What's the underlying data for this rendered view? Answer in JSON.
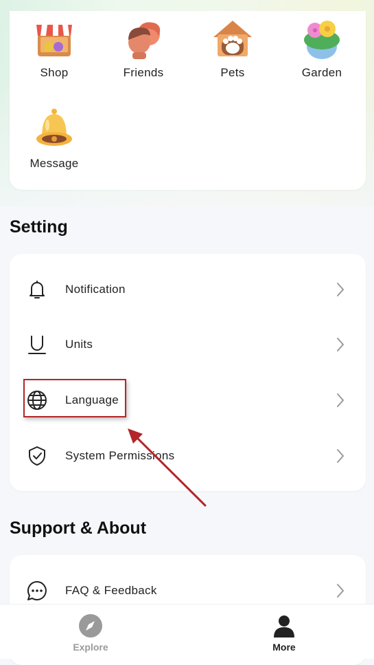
{
  "features": [
    {
      "label": "Shop",
      "icon": "shop-icon"
    },
    {
      "label": "Friends",
      "icon": "friends-icon"
    },
    {
      "label": "Pets",
      "icon": "pets-icon"
    },
    {
      "label": "Garden",
      "icon": "garden-icon"
    },
    {
      "label": "Message",
      "icon": "message-bell-icon"
    }
  ],
  "setting": {
    "title": "Setting",
    "items": [
      {
        "label": "Notification",
        "icon": "bell-outline-icon"
      },
      {
        "label": "Units",
        "icon": "units-icon"
      },
      {
        "label": "Language",
        "icon": "globe-icon"
      },
      {
        "label": "System Permissions",
        "icon": "shield-check-icon"
      }
    ]
  },
  "support": {
    "title": "Support & About",
    "items": [
      {
        "label": "FAQ & Feedback",
        "icon": "chat-bubble-icon"
      }
    ]
  },
  "bottom_nav": [
    {
      "label": "Explore",
      "icon": "compass-icon",
      "active": false
    },
    {
      "label": "More",
      "icon": "person-icon",
      "active": true
    }
  ],
  "colors": {
    "annotation": "#b5242a",
    "nav_active": "#222222",
    "nav_inactive": "#9a9a9a"
  }
}
